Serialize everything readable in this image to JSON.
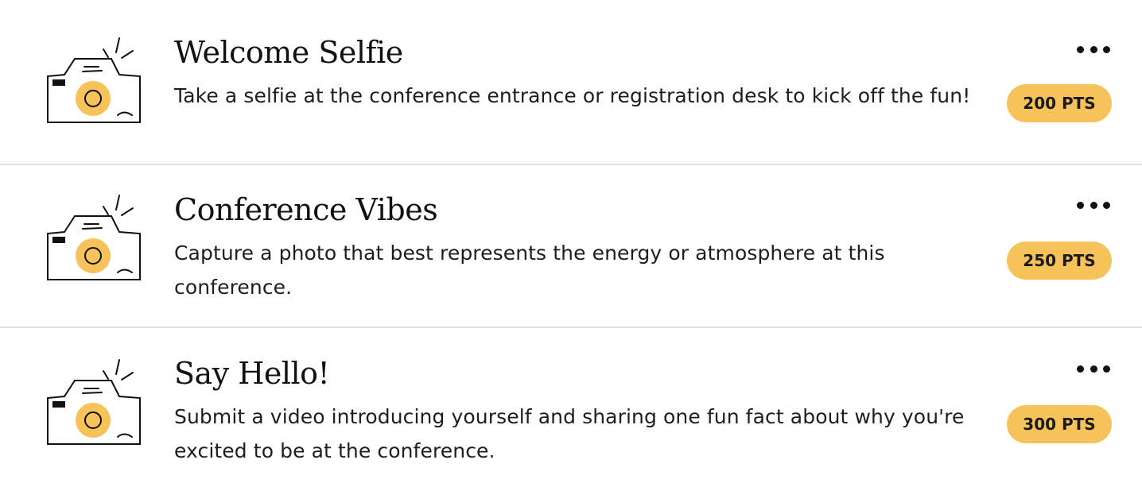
{
  "colors": {
    "accent": "#f6c35b",
    "divider": "#e2e2e2",
    "text": "#1a1a1a"
  },
  "challenges": [
    {
      "icon": "camera-icon",
      "title": "Welcome Selfie",
      "description": "Take a selfie at the conference entrance or registration desk to kick off the fun!",
      "points": "200 PTS"
    },
    {
      "icon": "camera-icon",
      "title": "Conference Vibes",
      "description": "Capture a photo that best represents the energy or atmosphere at this conference.",
      "points": "250 PTS"
    },
    {
      "icon": "camera-icon",
      "title": "Say Hello!",
      "description": "Submit a video introducing yourself and sharing one fun fact about why you're excited to be at the conference.",
      "points": "300 PTS"
    }
  ]
}
